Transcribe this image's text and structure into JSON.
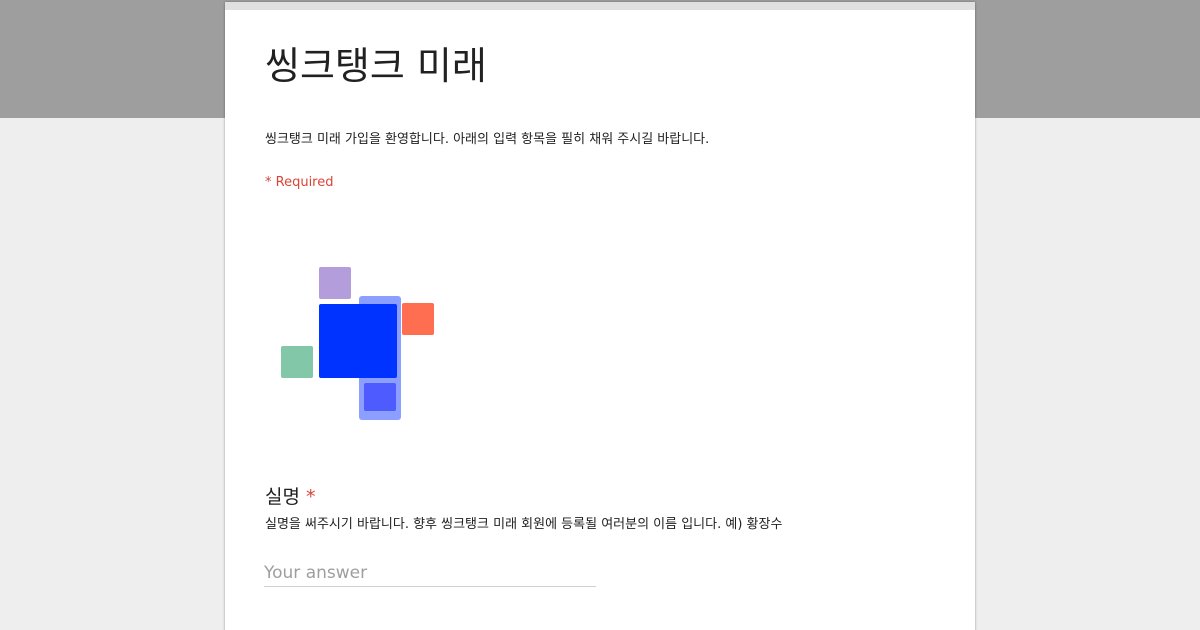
{
  "form": {
    "title": "씽크탱크 미래",
    "description": "씽크탱크 미래 가입을 환영합니다. 아래의 입력 항목을 필히 채워 주시길 바랍니다.",
    "required_note": "* Required"
  },
  "logo": {
    "icon": "thinktank-logo-squares",
    "colors": {
      "purple": "#b39ddb",
      "main_blue": "#0033ff",
      "light_blue": "#8c9eff",
      "mid_blue": "#4d5bff",
      "coral": "#ff6e50",
      "green": "#81c7a8"
    }
  },
  "question": {
    "title": "실명",
    "required_mark": "*",
    "description": "실명을 써주시기 바랍니다. 향후 씽크탱크 미래 회원에 등록될 여러분의 이름 입니다. 예) 황장수",
    "answer_value": "",
    "answer_placeholder": "Your answer"
  },
  "colors": {
    "header_band": "#9e9e9e",
    "page_background": "#eeeeee",
    "card_background": "#ffffff",
    "required": "#db4437"
  }
}
